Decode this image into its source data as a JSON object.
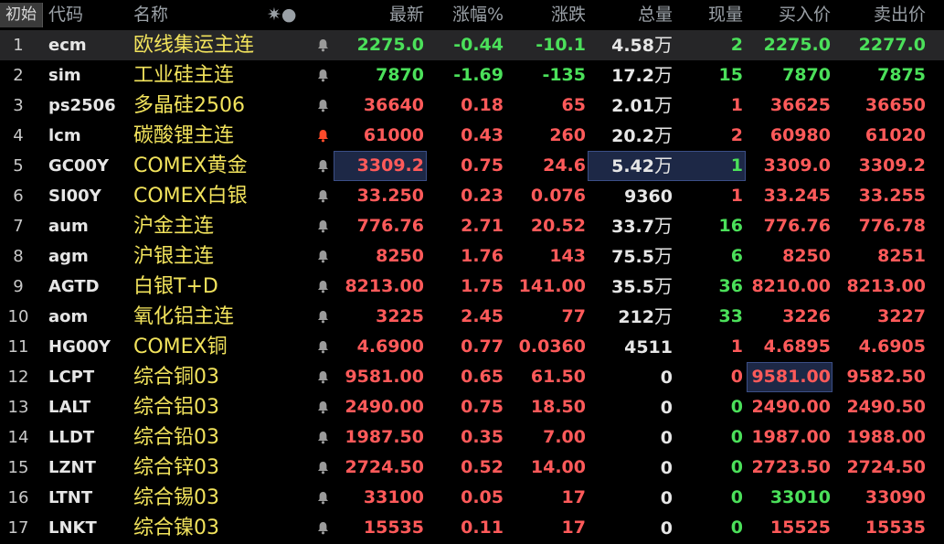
{
  "header": {
    "init": "初始",
    "code": "代码",
    "name": "名称",
    "star_icon": "✷●",
    "last": "最新",
    "pct": "涨幅%",
    "chg": "涨跌",
    "vol": "总量",
    "cur": "现量",
    "bid": "买入价",
    "ask": "卖出价"
  },
  "rows": [
    {
      "no": "1",
      "code": "ecm",
      "name": "欧线集运主连",
      "last": "2275.0",
      "pct": "-0.44",
      "chg": "-10.1",
      "vol": "4.58",
      "vol_unit": "万",
      "cur": "2",
      "bid": "2275.0",
      "ask": "2277.0"
    },
    {
      "no": "2",
      "code": "sim",
      "name": "工业硅主连",
      "last": "7870",
      "pct": "-1.69",
      "chg": "-135",
      "vol": "17.2",
      "vol_unit": "万",
      "cur": "15",
      "bid": "7870",
      "ask": "7875"
    },
    {
      "no": "3",
      "code": "ps2506",
      "name": "多晶硅2506",
      "last": "36640",
      "pct": "0.18",
      "chg": "65",
      "vol": "2.01",
      "vol_unit": "万",
      "cur": "1",
      "bid": "36625",
      "ask": "36650"
    },
    {
      "no": "4",
      "code": "lcm",
      "name": "碳酸锂主连",
      "last": "61000",
      "pct": "0.43",
      "chg": "260",
      "vol": "20.2",
      "vol_unit": "万",
      "cur": "2",
      "bid": "60980",
      "ask": "61020"
    },
    {
      "no": "5",
      "code": "GC00Y",
      "name": "COMEX黄金",
      "last": "3309.2",
      "pct": "0.75",
      "chg": "24.6",
      "vol": "5.42",
      "vol_unit": "万",
      "cur": "1",
      "bid": "3309.0",
      "ask": "3309.2"
    },
    {
      "no": "6",
      "code": "SI00Y",
      "name": "COMEX白银",
      "last": "33.250",
      "pct": "0.23",
      "chg": "0.076",
      "vol": "9360",
      "vol_unit": "",
      "cur": "1",
      "bid": "33.245",
      "ask": "33.255"
    },
    {
      "no": "7",
      "code": "aum",
      "name": "沪金主连",
      "last": "776.76",
      "pct": "2.71",
      "chg": "20.52",
      "vol": "33.7",
      "vol_unit": "万",
      "cur": "16",
      "bid": "776.76",
      "ask": "776.78"
    },
    {
      "no": "8",
      "code": "agm",
      "name": "沪银主连",
      "last": "8250",
      "pct": "1.76",
      "chg": "143",
      "vol": "75.5",
      "vol_unit": "万",
      "cur": "6",
      "bid": "8250",
      "ask": "8251"
    },
    {
      "no": "9",
      "code": "AGTD",
      "name": "白银T+D",
      "last": "8213.00",
      "pct": "1.75",
      "chg": "141.00",
      "vol": "35.5",
      "vol_unit": "万",
      "cur": "36",
      "bid": "8210.00",
      "ask": "8213.00"
    },
    {
      "no": "10",
      "code": "aom",
      "name": "氧化铝主连",
      "last": "3225",
      "pct": "2.45",
      "chg": "77",
      "vol": "212",
      "vol_unit": "万",
      "cur": "33",
      "bid": "3226",
      "ask": "3227"
    },
    {
      "no": "11",
      "code": "HG00Y",
      "name": "COMEX铜",
      "last": "4.6900",
      "pct": "0.77",
      "chg": "0.0360",
      "vol": "4511",
      "vol_unit": "",
      "cur": "1",
      "bid": "4.6895",
      "ask": "4.6905"
    },
    {
      "no": "12",
      "code": "LCPT",
      "name": "综合铜03",
      "last": "9581.00",
      "pct": "0.65",
      "chg": "61.50",
      "vol": "0",
      "vol_unit": "",
      "cur": "0",
      "bid": "9581.00",
      "ask": "9582.50"
    },
    {
      "no": "13",
      "code": "LALT",
      "name": "综合铝03",
      "last": "2490.00",
      "pct": "0.75",
      "chg": "18.50",
      "vol": "0",
      "vol_unit": "",
      "cur": "0",
      "bid": "2490.00",
      "ask": "2490.50"
    },
    {
      "no": "14",
      "code": "LLDT",
      "name": "综合铅03",
      "last": "1987.50",
      "pct": "0.35",
      "chg": "7.00",
      "vol": "0",
      "vol_unit": "",
      "cur": "0",
      "bid": "1987.00",
      "ask": "1988.00"
    },
    {
      "no": "15",
      "code": "LZNT",
      "name": "综合锌03",
      "last": "2724.50",
      "pct": "0.52",
      "chg": "14.00",
      "vol": "0",
      "vol_unit": "",
      "cur": "0",
      "bid": "2723.50",
      "ask": "2724.50"
    },
    {
      "no": "16",
      "code": "LTNT",
      "name": "综合锡03",
      "last": "33100",
      "pct": "0.05",
      "chg": "17",
      "vol": "0",
      "vol_unit": "",
      "cur": "0",
      "bid": "33010",
      "ask": "33090"
    },
    {
      "no": "17",
      "code": "LNKT",
      "name": "综合镍03",
      "last": "15535",
      "pct": "0.11",
      "chg": "17",
      "vol": "0",
      "vol_unit": "",
      "cur": "0",
      "bid": "15525",
      "ask": "15535"
    }
  ],
  "colors": {
    "up": "#ff5a5a",
    "down": "#4be05a",
    "name": "#f2e35c",
    "neutral": "#e6e6e6",
    "alert_bell": "#ff4a2a"
  }
}
